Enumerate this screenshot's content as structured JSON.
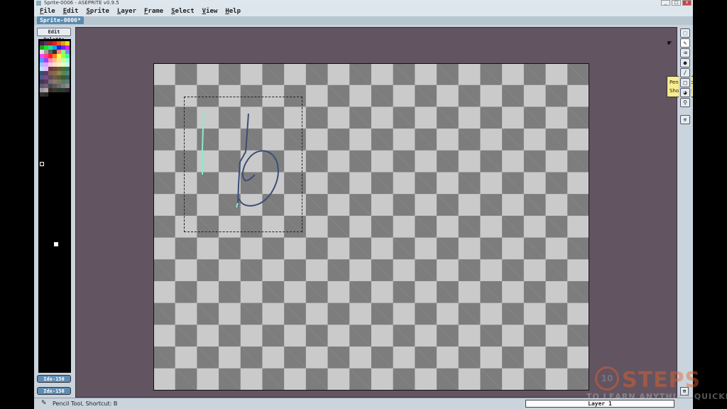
{
  "window": {
    "title": "Sprite-0006 - ASEPRITE v0.9.5",
    "buttons": [
      "_",
      "□",
      "x"
    ]
  },
  "menu": [
    "File",
    "Edit",
    "Sprite",
    "Layer",
    "Frame",
    "Select",
    "View",
    "Help"
  ],
  "tabs": [
    {
      "label": "Sprite-0006*",
      "active": true
    }
  ],
  "left_panel": {
    "edit_palette_label": "Edit Palette",
    "index_buttons": [
      "Idx-150",
      "Idx-150"
    ]
  },
  "palette_colors": [
    "#402040",
    "#603060",
    "#a02020",
    "#e02020",
    "#e06020",
    "#e0a020",
    "#e0e020",
    "#20a020",
    "#20e020",
    "#20e0a0",
    "#20a0e0",
    "#2020e0",
    "#8020e0",
    "#e020e0",
    "#e0e0e0",
    "#a0a0a0",
    "#606060",
    "#303030",
    "#ff8080",
    "#80ff80",
    "#8080ff",
    "#ff40ff",
    "#ff4080",
    "#ff2020",
    "#ff8020",
    "#ffff40",
    "#a0ff40",
    "#40ffa0",
    "#40a0ff",
    "#a040ff",
    "#ff80c0",
    "#ffc080",
    "#ffe0a0",
    "#c0ffa0",
    "#a0ffe0",
    "#a0c0ff",
    "#e0a0ff",
    "#ffc0e0",
    "#ffe0c0",
    "#fff0c0",
    "#e0ffc0",
    "#c0ffe0",
    "#c0e0ff",
    "#e0c0ff",
    "#6a3a3a",
    "#6a4a3a",
    "#6a5a3a",
    "#4a6a3a",
    "#3a6a5a",
    "#3a4a6a",
    "#5a3a6a",
    "#8a5a5a",
    "#8a6a4a",
    "#8a8a4a",
    "#5a8a4a",
    "#4a8a7a",
    "#4a5a8a",
    "#7a4a8a",
    "#5a4a5a",
    "#6a5a4a",
    "#5a5a3a",
    "#3a5a3a",
    "#3a5a5a",
    "#3a3a5a",
    "#5a3a5a",
    "#7a6a7a",
    "#8a7a6a",
    "#7a7a5a",
    "#5a7a5a",
    "#5a7a7a",
    "#5a5a7a",
    "#7a5a7a",
    "#4a4a4a",
    "#5a5a5a",
    "#6a6a6a",
    "#7a7a7a",
    "#8a8a8a",
    "#9a9a9a",
    "#aaaaaa",
    "#3a2a2a",
    "#3a3a2a",
    "#2a3a2a",
    "#2a3a3a",
    "#2a2a3a",
    "#3a2a3a",
    "#2a2a2a"
  ],
  "tooltip": {
    "line1": "Pencil Tool",
    "line2": "Shortcut: B"
  },
  "tools": [
    {
      "name": "marquee-tool",
      "glyph": "⬚"
    },
    {
      "name": "pencil-tool",
      "glyph": "✎"
    },
    {
      "name": "eraser-tool",
      "glyph": "⌫"
    },
    {
      "name": "bucket-tool",
      "glyph": "●"
    },
    {
      "name": "line-tool",
      "glyph": "/"
    },
    {
      "name": "rectangle-tool",
      "glyph": "□"
    },
    {
      "name": "ellipse-tool",
      "glyph": "◕"
    },
    {
      "name": "eyedropper-tool",
      "glyph": "⚲"
    },
    {
      "name": "move-tool",
      "glyph": "⇈"
    }
  ],
  "status": {
    "message": "Pencil Tool, Shortcut: B",
    "layer": "Layer 1"
  },
  "colors": {
    "editor_bg": "#625461",
    "accent": "#5a8ab0",
    "stroke_blue": "#3a4e78",
    "stroke_cyan": "#8ee8d0"
  },
  "watermark": {
    "brand": "STEPS",
    "number": "10",
    "tagline": "TO LEARN ANYTHING QUICKLY"
  }
}
